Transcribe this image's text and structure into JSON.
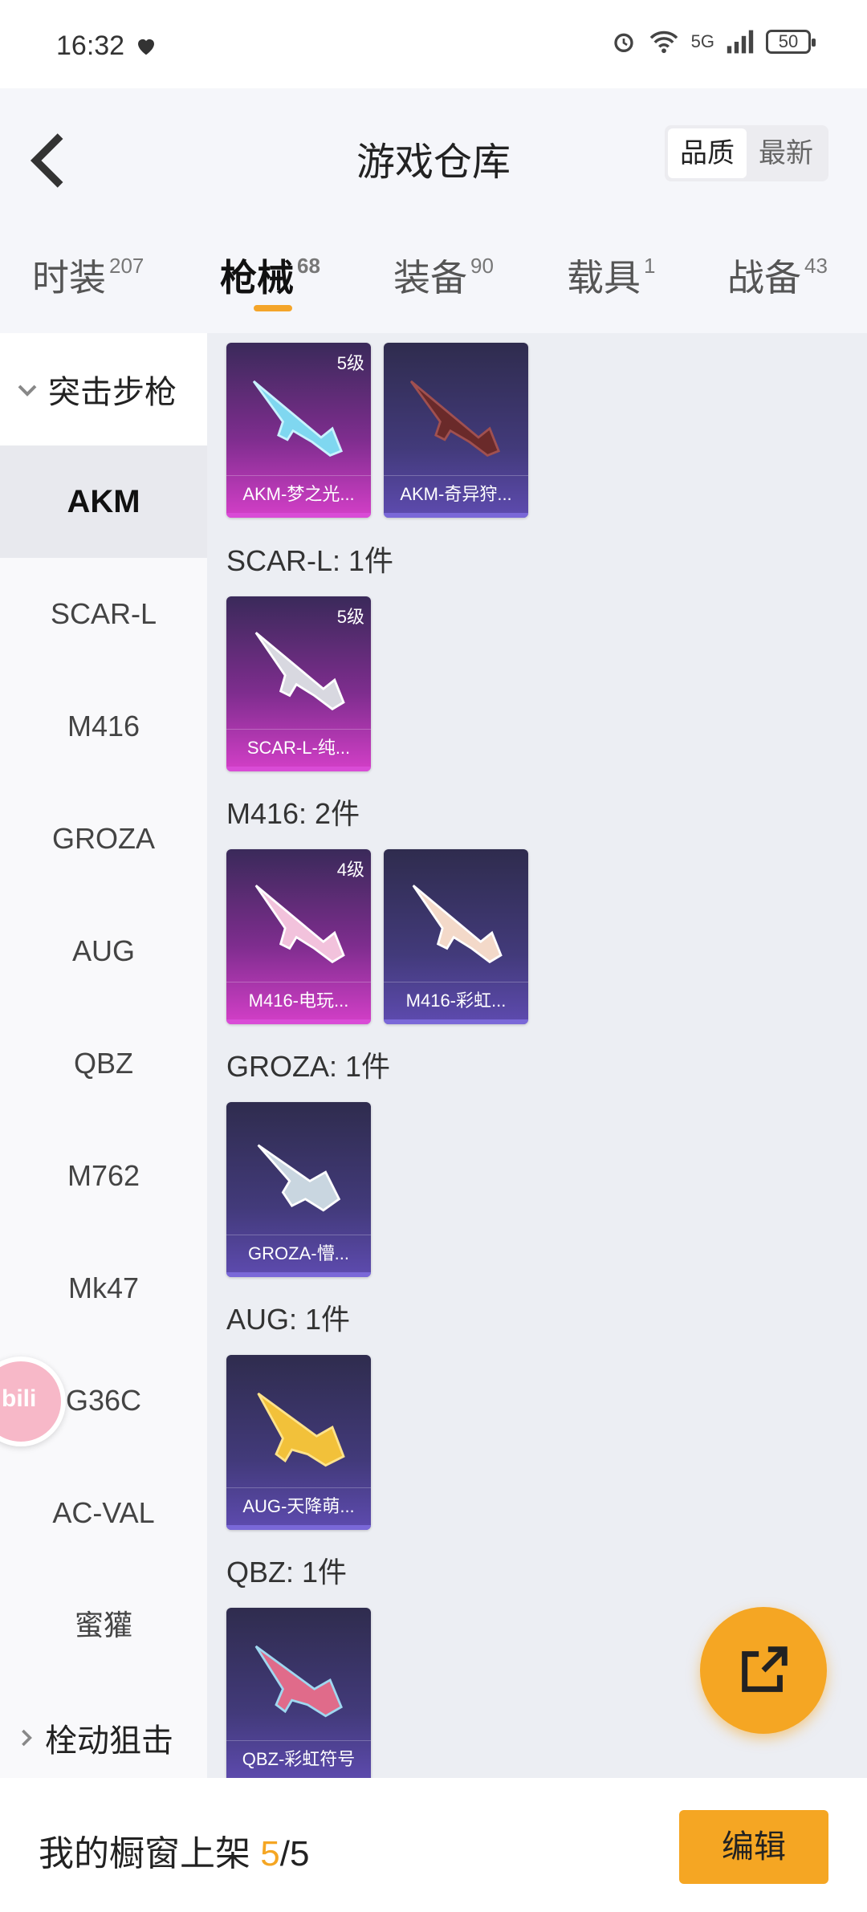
{
  "status": {
    "time": "16:32",
    "battery": "50",
    "net": "5G"
  },
  "header": {
    "title": "游戏仓库",
    "sort_options": [
      "品质",
      "最新"
    ],
    "sort_selected": "品质"
  },
  "tabs": [
    {
      "label": "时装",
      "count": "207"
    },
    {
      "label": "枪械",
      "count": "68"
    },
    {
      "label": "装备",
      "count": "90"
    },
    {
      "label": "载具",
      "count": "1"
    },
    {
      "label": "战备",
      "count": "43"
    }
  ],
  "active_tab": "枪械",
  "sidebar": {
    "category": "突击步枪",
    "items": [
      "AKM",
      "SCAR-L",
      "M416",
      "GROZA",
      "AUG",
      "QBZ",
      "M762",
      "Mk47",
      "G36C",
      "AC-VAL",
      "蜜獾"
    ],
    "selected": "AKM",
    "next_category": "栓动狙击"
  },
  "groups": [
    {
      "title": "",
      "cards": [
        {
          "name": "AKM-梦之光...",
          "level": "5级",
          "quality": "pink"
        },
        {
          "name": "AKM-奇异狩...",
          "level": "",
          "quality": "purple"
        }
      ]
    },
    {
      "title": "SCAR-L: 1件",
      "cards": [
        {
          "name": "SCAR-L-纯...",
          "level": "5级",
          "quality": "pink"
        }
      ]
    },
    {
      "title": "M416: 2件",
      "cards": [
        {
          "name": "M416-电玩...",
          "level": "4级",
          "quality": "pink"
        },
        {
          "name": "M416-彩虹...",
          "level": "",
          "quality": "purple"
        }
      ]
    },
    {
      "title": "GROZA: 1件",
      "cards": [
        {
          "name": "GROZA-懵...",
          "level": "",
          "quality": "purple"
        }
      ]
    },
    {
      "title": "AUG: 1件",
      "cards": [
        {
          "name": "AUG-天降萌...",
          "level": "",
          "quality": "purple"
        }
      ]
    },
    {
      "title": "QBZ: 1件",
      "cards": [
        {
          "name": "QBZ-彩虹符号",
          "level": "",
          "quality": "purple"
        }
      ]
    }
  ],
  "float_logo": "bili",
  "bottom": {
    "label": "我的橱窗上架 ",
    "current": "5",
    "separator": "/",
    "total": "5",
    "edit_label": "编辑"
  }
}
